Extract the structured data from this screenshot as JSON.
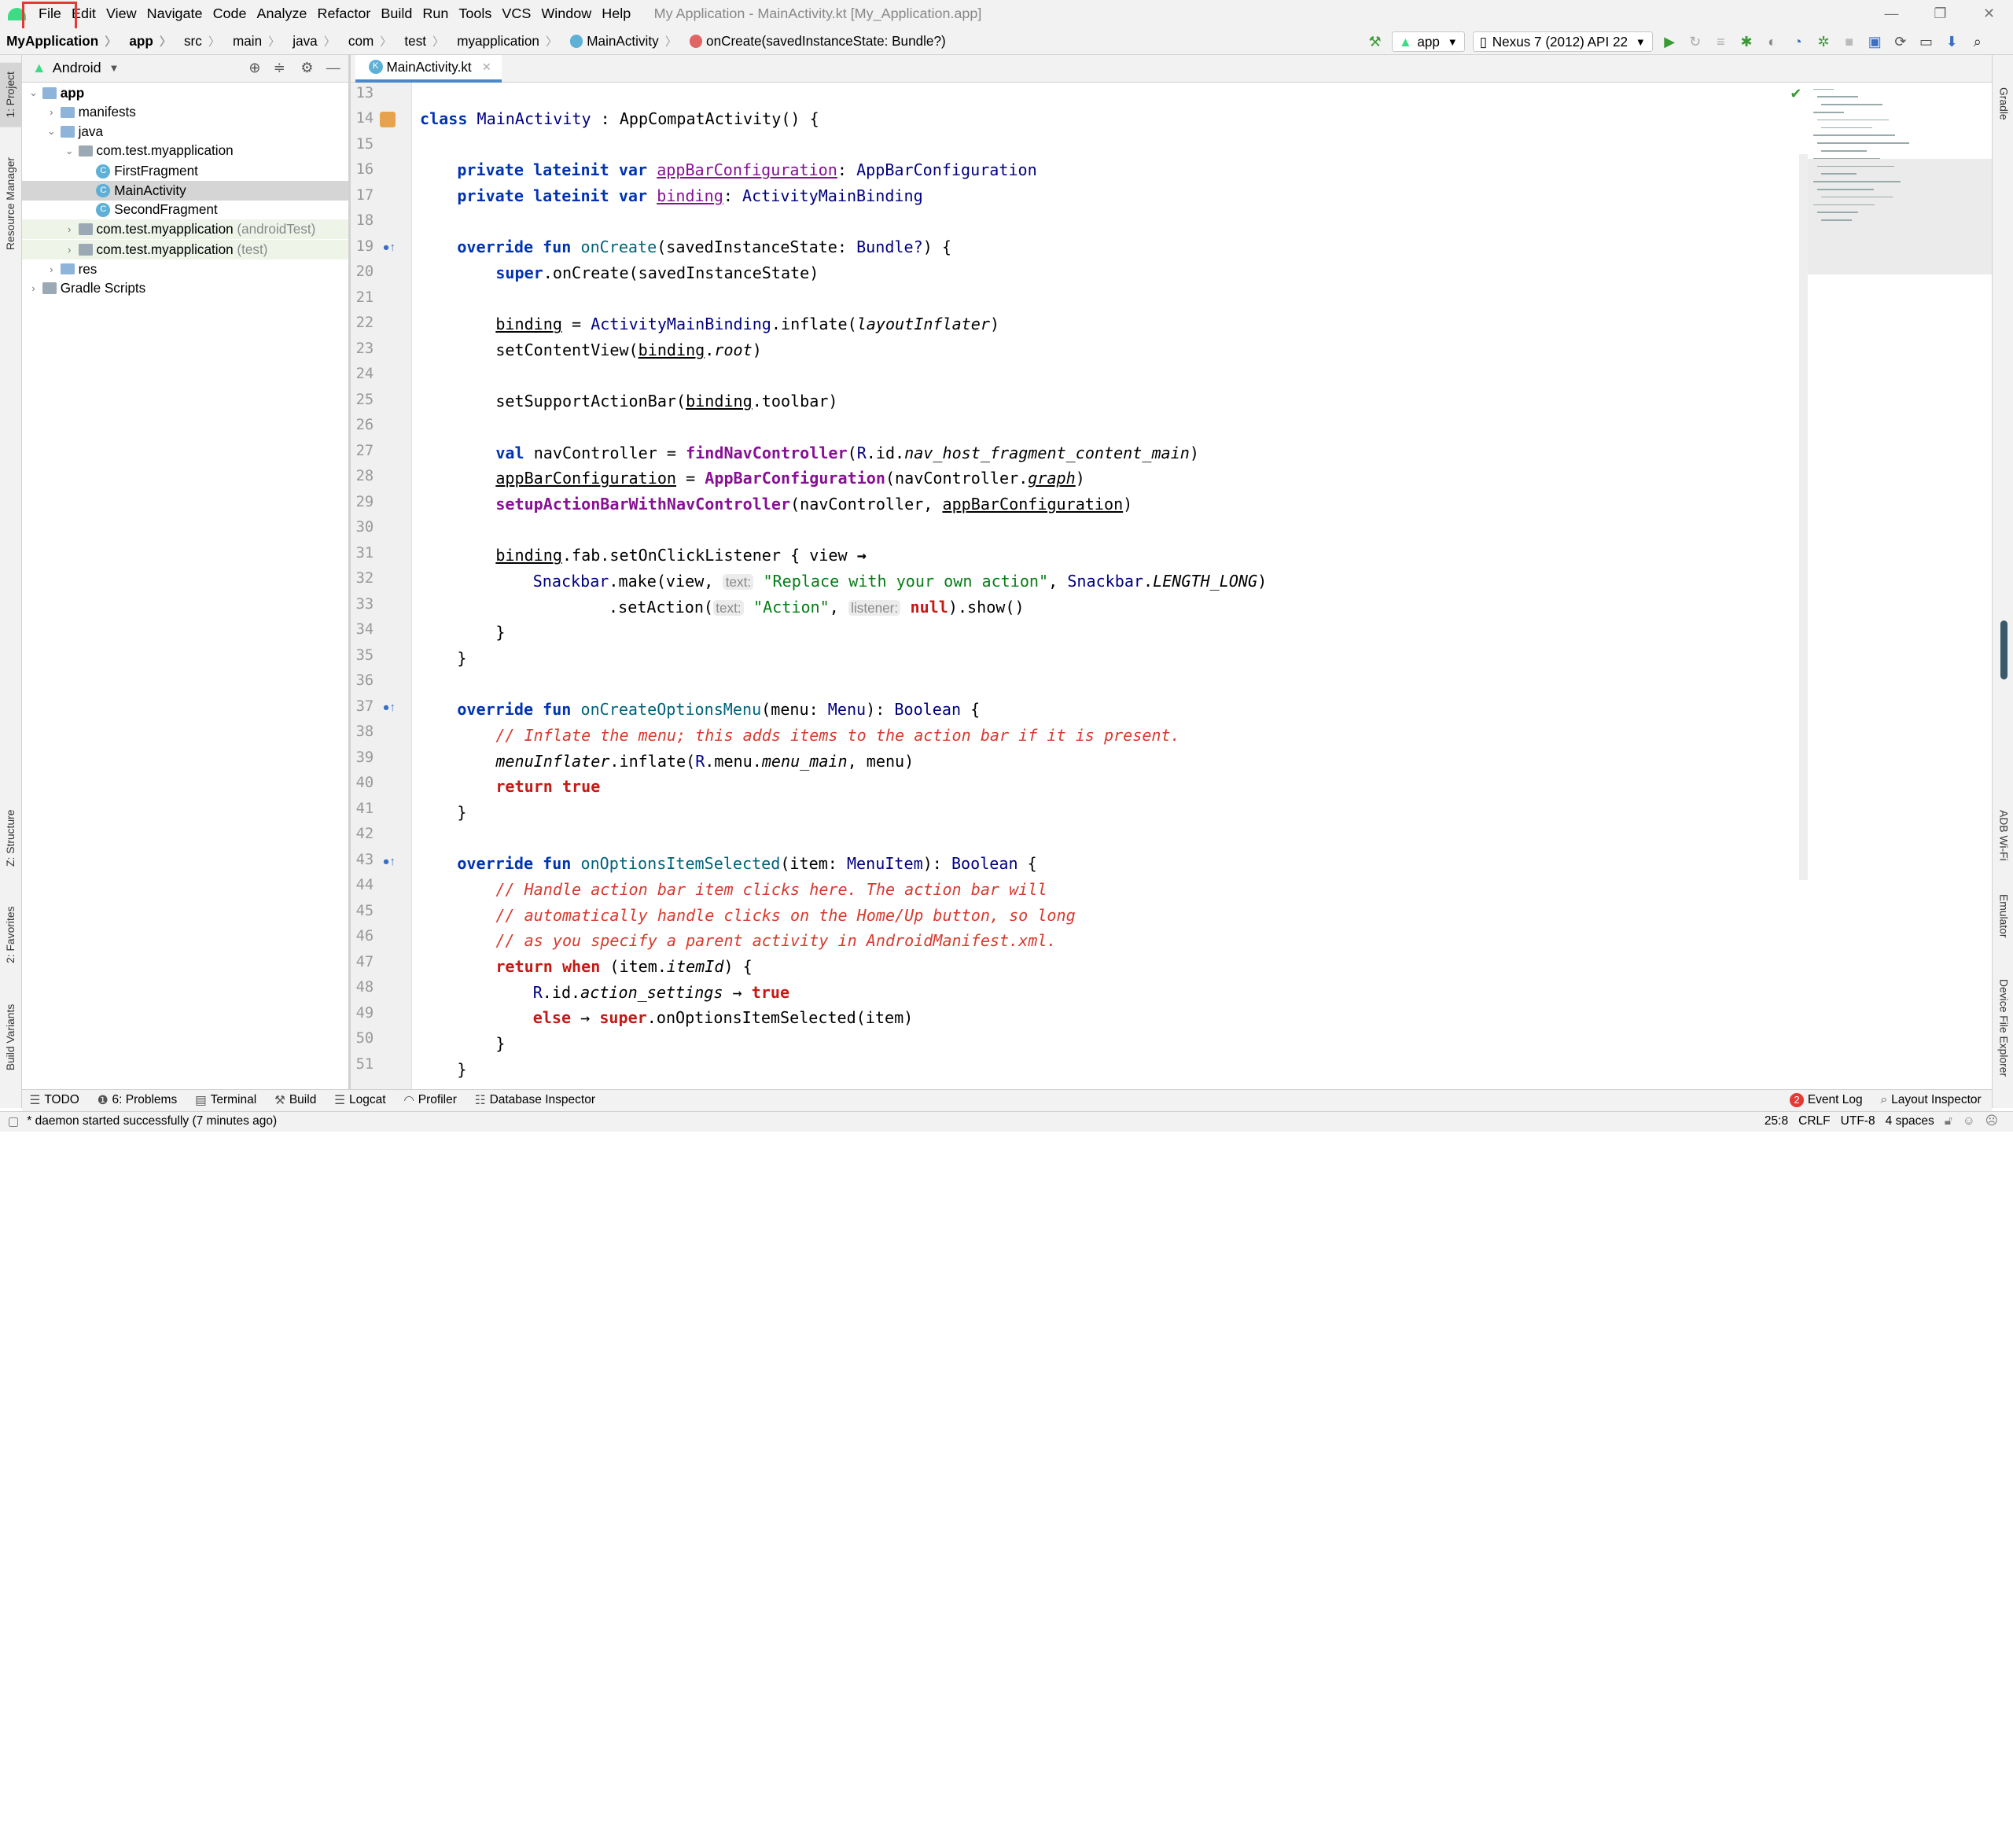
{
  "menu": {
    "items": [
      "File",
      "Edit",
      "View",
      "Navigate",
      "Code",
      "Analyze",
      "Refactor",
      "Build",
      "Run",
      "Tools",
      "VCS",
      "Window",
      "Help"
    ],
    "title": "My Application - MainActivity.kt [My_Application.app]"
  },
  "nav": {
    "crumbs": [
      "MyApplication",
      "app",
      "src",
      "main",
      "java",
      "com",
      "test",
      "myapplication",
      "MainActivity",
      "onCreate(savedInstanceState: Bundle?)"
    ]
  },
  "toolbar": {
    "config": "app",
    "device": "Nexus 7 (2012) API 22"
  },
  "left_tabs": {
    "project": "1: Project",
    "resource": "Resource Manager",
    "structure": "Z: Structure",
    "favorites": "2: Favorites",
    "build_variants": "Build Variants"
  },
  "right_tabs": {
    "gradle": "Gradle",
    "adb": "ADB Wi-Fi",
    "emulator": "Emulator",
    "device": "Device File Explorer"
  },
  "project": {
    "view": "Android",
    "tree": [
      {
        "label": "app",
        "bold": true
      },
      {
        "label": "manifests"
      },
      {
        "label": "java"
      },
      {
        "label": "com.test.myapplication"
      },
      {
        "label": "FirstFragment"
      },
      {
        "label": "MainActivity"
      },
      {
        "label": "SecondFragment"
      },
      {
        "label": "com.test.myapplication",
        "suffix": "(androidTest)"
      },
      {
        "label": "com.test.myapplication",
        "suffix": "(test)"
      },
      {
        "label": "res"
      },
      {
        "label": "Gradle Scripts"
      }
    ]
  },
  "editor": {
    "tab": "MainActivity.kt",
    "line_numbers": [
      "13",
      "14",
      "15",
      "16",
      "17",
      "18",
      "19",
      "20",
      "21",
      "22",
      "23",
      "24",
      "25",
      "26",
      "27",
      "28",
      "29",
      "30",
      "31",
      "32",
      "33",
      "34",
      "35",
      "36",
      "37",
      "38",
      "39",
      "40",
      "41",
      "42",
      "43",
      "44",
      "45",
      "46",
      "47",
      "48",
      "49",
      "50",
      "51"
    ]
  },
  "code": {
    "l14": {
      "a": "class ",
      "b": "MainActivity",
      "c": " : AppCompatActivity() {"
    },
    "l16": {
      "a": "private lateinit var ",
      "b": "appBarConfiguration",
      "c": ": ",
      "d": "AppBarConfiguration"
    },
    "l17": {
      "a": "private lateinit var ",
      "b": "binding",
      "c": ": ",
      "d": "ActivityMainBinding"
    },
    "l19": {
      "a": "override fun ",
      "b": "onCreate",
      "c": "(savedInstanceState: ",
      "d": "Bundle?",
      "e": ") {"
    },
    "l20": {
      "a": "super",
      "b": ".onCreate(savedInstanceState)"
    },
    "l22": {
      "a": "binding",
      "b": " = ",
      "c": "ActivityMainBinding",
      "d": ".inflate(",
      "e": "layoutInflater",
      "f": ")"
    },
    "l23": {
      "a": "setContentView(",
      "b": "binding",
      "c": ".",
      "d": "root",
      "e": ")"
    },
    "l25": {
      "a": "setSupportActionBar(",
      "b": "binding",
      "c": ".toolbar)"
    },
    "l27": {
      "a": "val ",
      "b": "navController = ",
      "c": "findNavController",
      "d": "(",
      "e": "R",
      "f": ".id.",
      "g": "nav_host_fragment_content_main",
      "h": ")"
    },
    "l28": {
      "a": "appBarConfiguration",
      "b": " = ",
      "c": "AppBarConfiguration",
      "d": "(navController.",
      "e": "graph",
      "f": ")"
    },
    "l29": {
      "a": "setupActionBarWithNavController",
      "b": "(navController, ",
      "c": "appBarConfiguration",
      "d": ")"
    },
    "l31": {
      "a": "binding",
      "b": ".fab.setOnClickListener { view ",
      "c": "→"
    },
    "l32": {
      "a": "Snackbar",
      "b": ".make(view, ",
      "h": "text:",
      "c": "\"Replace with your own action\"",
      "d": ", ",
      "e": "Snackbar",
      "f": ".",
      "g": "LENGTH_LONG",
      "i": ")"
    },
    "l33": {
      "a": ".setAction(",
      "h1": "text:",
      "b": "\"Action\"",
      "c": ", ",
      "h2": "listener:",
      "d": "null",
      "e": ").show()"
    },
    "l34": {
      "a": "}"
    },
    "l35": {
      "a": "}"
    },
    "l37": {
      "a": "override fun ",
      "b": "onCreateOptionsMenu",
      "c": "(menu: ",
      "d": "Menu",
      "e": "): ",
      "f": "Boolean",
      "g": " {"
    },
    "l38": {
      "a": "// Inflate the menu; this adds items to the action bar if it is present."
    },
    "l39": {
      "a": "menuInflater",
      "b": ".inflate(",
      "c": "R",
      "d": ".menu.",
      "e": "menu_main",
      "f": ", menu)"
    },
    "l40": {
      "a": "return true"
    },
    "l41": {
      "a": "}"
    },
    "l43": {
      "a": "override fun ",
      "b": "onOptionsItemSelected",
      "c": "(item: ",
      "d": "MenuItem",
      "e": "): ",
      "f": "Boolean",
      "g": " {"
    },
    "l44": {
      "a": "// Handle action bar item clicks here. The action bar will"
    },
    "l45": {
      "a": "// automatically handle clicks on the Home/Up button, so long"
    },
    "l46": {
      "a": "// as you specify a parent activity in AndroidManifest.xml."
    },
    "l47": {
      "a": "return when ",
      "b": "(item.",
      "c": "itemId",
      "d": ") {"
    },
    "l48": {
      "a": "R",
      "b": ".id.",
      "c": "action_settings",
      "d": " → ",
      "e": "true"
    },
    "l49": {
      "a": "else ",
      "b": "→ ",
      "c": "super",
      "d": ".onOptionsItemSelected(item)"
    },
    "l50": {
      "a": "}"
    },
    "l51": {
      "a": "}"
    }
  },
  "bottom": {
    "todo": "TODO",
    "problems": "6: Problems",
    "terminal": "Terminal",
    "build": "Build",
    "logcat": "Logcat",
    "profiler": "Profiler",
    "db": "Database Inspector",
    "event_log": "Event Log",
    "event_count": "2",
    "layout_inspector": "Layout Inspector"
  },
  "status": {
    "message": "* daemon started successfully (7 minutes ago)",
    "position": "25:8",
    "line_sep": "CRLF",
    "encoding": "UTF-8",
    "indent": "4 spaces"
  },
  "colors": {
    "keyword": "#0033b3",
    "string": "#067d17",
    "comment_red": "#d73a2f",
    "highlight_box": "#e53935"
  }
}
